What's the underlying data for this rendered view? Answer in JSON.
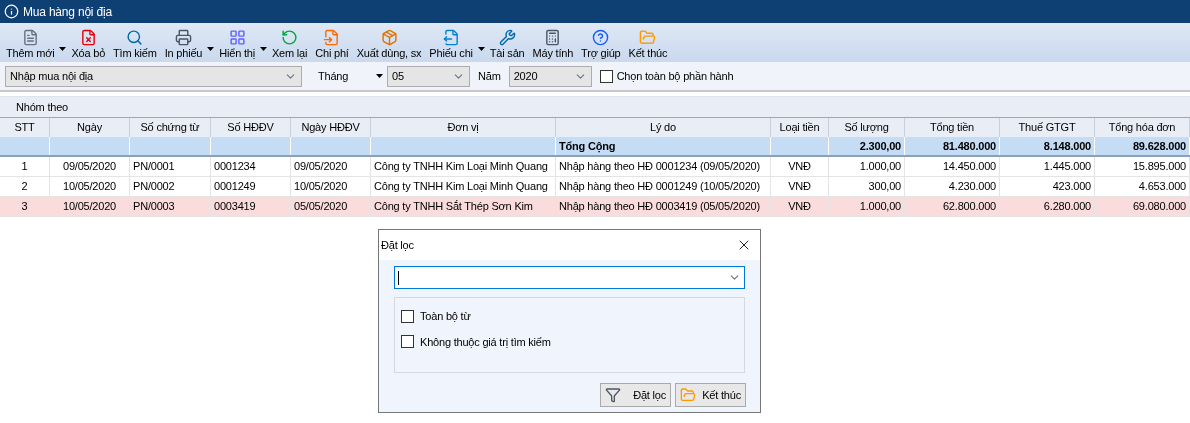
{
  "window": {
    "title": "Mua hàng nội địa"
  },
  "toolbar": [
    {
      "label": "Thêm mới",
      "has_menu": true
    },
    {
      "label": "Xóa bỏ",
      "has_menu": false
    },
    {
      "label": "Tìm kiếm",
      "has_menu": false
    },
    {
      "label": "In phiếu",
      "has_menu": true
    },
    {
      "label": "Hiển thị",
      "has_menu": true
    },
    {
      "label": "Xem lại",
      "has_menu": false
    },
    {
      "label": "Chi phí",
      "has_menu": false
    },
    {
      "label": "Xuất dùng, sx",
      "has_menu": false
    },
    {
      "label": "Phiếu chi",
      "has_menu": true
    },
    {
      "label": "Tài sản",
      "has_menu": false
    },
    {
      "label": "Máy tính",
      "has_menu": false
    },
    {
      "label": "Trợ giúp",
      "has_menu": false
    },
    {
      "label": "Kết thúc",
      "has_menu": false
    }
  ],
  "filters": {
    "module": "Nhập mua nội địa",
    "month_label": "Tháng",
    "month": "05",
    "year_label": "Năm",
    "year": "2020",
    "select_all": {
      "label": "Chọn toàn bộ phần hành",
      "checked": false
    }
  },
  "group_by": "Nhóm theo",
  "table": {
    "columns": [
      "STT",
      "Ngày",
      "Số chứng từ",
      "Số HĐĐV",
      "Ngày HĐĐV",
      "Đơn vị",
      "Lý do",
      "Loại tiền",
      "Số lượng",
      "Tổng tiền",
      "Thuế GTGT",
      "Tổng hóa đơn"
    ],
    "total": {
      "label": "Tổng Cộng",
      "quantity": "2.300,00",
      "amount": "81.480.000",
      "vat": "8.148.000",
      "invoice_total": "89.628.000"
    },
    "rows": [
      {
        "selected": false,
        "cells": [
          "1",
          "09/05/2020",
          "PN/0001",
          "0001234",
          "09/05/2020",
          "Công ty TNHH Kim Loại Minh Quang",
          "Nhập hàng theo HĐ 0001234 (09/05/2020)",
          "VNĐ",
          "1.000,00",
          "14.450.000",
          "1.445.000",
          "15.895.000"
        ]
      },
      {
        "selected": false,
        "cells": [
          "2",
          "10/05/2020",
          "PN/0002",
          "0001249",
          "10/05/2020",
          "Công ty TNHH Kim Loại Minh Quang",
          "Nhập hàng theo HĐ 0001249 (10/05/2020)",
          "VNĐ",
          "300,00",
          "4.230.000",
          "423.000",
          "4.653.000"
        ]
      },
      {
        "selected": true,
        "cells": [
          "3",
          "10/05/2020",
          "PN/0003",
          "0003419",
          "05/05/2020",
          "Công ty TNHH Sắt Thép Sơn Kim",
          "Nhập hàng theo HĐ 0003419 (05/05/2020)",
          "VNĐ",
          "1.000,00",
          "62.800.000",
          "6.280.000",
          "69.080.000"
        ]
      }
    ]
  },
  "dialog": {
    "title": "Đặt lọc",
    "options": [
      {
        "label": "Toàn bộ từ",
        "checked": false
      },
      {
        "label": "Không thuộc giá trị tìm kiếm",
        "checked": false
      }
    ],
    "buttons": [
      "Đặt lọc",
      "Kết thúc"
    ]
  }
}
